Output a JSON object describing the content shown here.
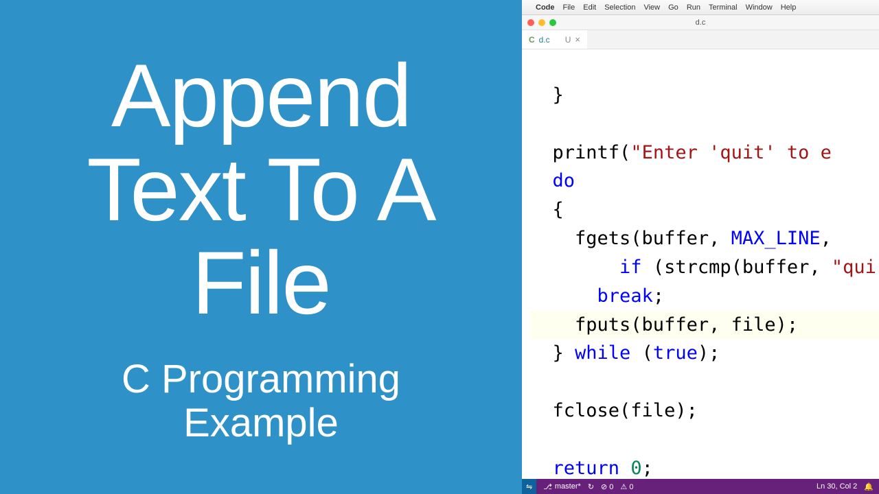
{
  "left": {
    "title_line1": "Append",
    "title_line2": "Text To A",
    "title_line3": "File",
    "subtitle_line1": "C Programming",
    "subtitle_line2": "Example"
  },
  "menubar": {
    "apple": "",
    "app": "Code",
    "items": [
      "File",
      "Edit",
      "Selection",
      "View",
      "Go",
      "Run",
      "Terminal",
      "Window",
      "Help"
    ]
  },
  "window": {
    "title": "d.c"
  },
  "tab": {
    "lang": "C",
    "name": "d.c",
    "dirty": "U",
    "close": "×"
  },
  "code": {
    "l1": "  }",
    "l2": "",
    "l3a": "  printf(",
    "l3b": "\"Enter 'quit' to e",
    "l4": "  do",
    "l5": "  {",
    "l6a": "    fgets(buffer, ",
    "l6b": "MAX_LINE",
    "l6c": ",",
    "l7a": "    if",
    "l7b": " (strcmp(buffer, ",
    "l7c": "\"qui",
    "l8": "      break;",
    "l9": "    fputs(buffer, file);",
    "l10a": "  } ",
    "l10b": "while",
    "l10c": " (",
    "l10d": "true",
    "l10e": ");",
    "l11": "",
    "l12": "  fclose(file);",
    "l13": "",
    "l14a": "  return ",
    "l14b": "0",
    "l14c": ";"
  },
  "statusbar": {
    "remote_icon": "⇋",
    "branch": "master*",
    "sync": "↻",
    "errors": "⊘ 0",
    "warnings": "⚠ 0",
    "cursor": "Ln 30, Col 2",
    "bell": "🔔"
  }
}
